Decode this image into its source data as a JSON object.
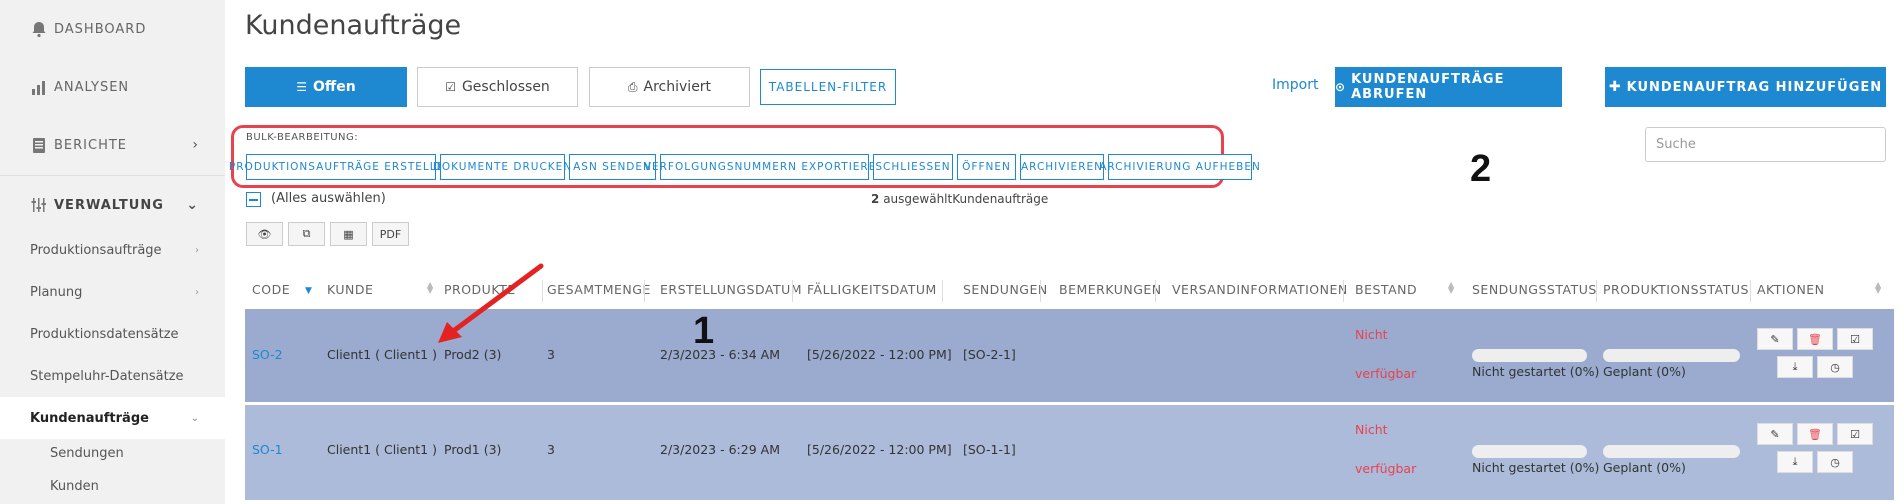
{
  "sidebar": {
    "dashboard": "DASHBOARD",
    "analysen": "ANALYSEN",
    "berichte": "BERICHTE",
    "verwaltung": "VERWALTUNG",
    "items": [
      {
        "label": "Produktionsaufträge"
      },
      {
        "label": "Planung"
      },
      {
        "label": "Produktionsdatensätze"
      },
      {
        "label": "Stempeluhr-Datensätze"
      },
      {
        "label": "Kundenaufträge"
      },
      {
        "label": "Sendungen"
      },
      {
        "label": "Kunden"
      }
    ]
  },
  "page": {
    "title": "Kundenaufträge"
  },
  "tabs": {
    "offen": "Offen",
    "geschlossen": "Geschlossen",
    "archiviert": "Archiviert",
    "filter": "TABELLEN-FILTER"
  },
  "actions": {
    "import": "Import",
    "abrufen": "KUNDENAUFTRÄGE ABRUFEN",
    "hinzufuegen": "KUNDENAUFTRAG HINZUFÜGEN"
  },
  "search": {
    "placeholder": "Suche"
  },
  "bulk": {
    "label": "BULK-BEARBEITUNG:",
    "buttons": [
      "PRODUKTIONSAUFTRÄGE ERSTELLEN",
      "DOKUMENTE DRUCKEN",
      "ASN SENDEN",
      "VERFOLGUNGSNUMMERN EXPORTIEREN",
      "SCHLIESSEN",
      "ÖFFNEN",
      "ARCHIVIEREN",
      "ARCHIVIERUNG AUFHEBEN"
    ]
  },
  "selection": {
    "select_all": "(Alles auswählen)",
    "count": "2",
    "text": "ausgewähltKundenaufträge"
  },
  "view_buttons": {
    "pdf": "PDF"
  },
  "table": {
    "headers": [
      "CODE",
      "KUNDE",
      "PRODUKTE",
      "GESAMTMENGE",
      "ERSTELLUNGSDATUM",
      "FÄLLIGKEITSDATUM",
      "SENDUNGEN",
      "BEMERKUNGEN",
      "VERSANDINFORMATIONEN",
      "BESTAND",
      "SENDUNGSSTATUS",
      "PRODUKTIONSSTATUS",
      "AKTIONEN"
    ],
    "rows": [
      {
        "code": "SO-2",
        "kunde": "Client1 ( Client1 )",
        "produkte": "Prod2 (3)",
        "menge": "3",
        "erstellung": "2/3/2023 - 6:34 AM",
        "faelligkeit": "[5/26/2022 - 12:00 PM]",
        "sendungen": "[SO-2-1]",
        "bestand_1": "Nicht",
        "bestand_2": "verfügbar",
        "sendungsstatus": "Nicht gestartet (0%)",
        "sendungsstatus_progress": 0,
        "produktionsstatus": "Geplant (0%)",
        "produktionsstatus_progress": 0
      },
      {
        "code": "SO-1",
        "kunde": "Client1 ( Client1 )",
        "produkte": "Prod1 (3)",
        "menge": "3",
        "erstellung": "2/3/2023 - 6:29 AM",
        "faelligkeit": "[5/26/2022 - 12:00 PM]",
        "sendungen": "[SO-1-1]",
        "bestand_1": "Nicht",
        "bestand_2": "verfügbar",
        "sendungsstatus": "Nicht gestartet (0%)",
        "sendungsstatus_progress": 0,
        "produktionsstatus": "Geplant (0%)",
        "produktionsstatus_progress": 0
      }
    ]
  },
  "annotations": {
    "one": "1",
    "two": "2"
  },
  "colors": {
    "accent": "#1e88d0",
    "annotation_red": "#e8424e",
    "row_selected_1": "#9aabcf",
    "row_selected_2": "#acbbda",
    "sidebar_bg": "#f1f1f1"
  },
  "icons": {
    "dashboard": "bell-icon",
    "analysen": "bar-chart-icon",
    "berichte": "book-icon",
    "verwaltung": "sliders-icon",
    "offen": "list-icon",
    "geschlossen": "check-square-icon",
    "archiviert": "inbox-icon",
    "abrufen": "circle-arrow-icon",
    "hinzufuegen": "plus-icon",
    "view": [
      "eye-icon",
      "copy-icon",
      "table-icon"
    ],
    "row_actions": [
      "edit-icon",
      "trash-icon",
      "check-square-icon",
      "download-icon",
      "clock-icon"
    ]
  }
}
